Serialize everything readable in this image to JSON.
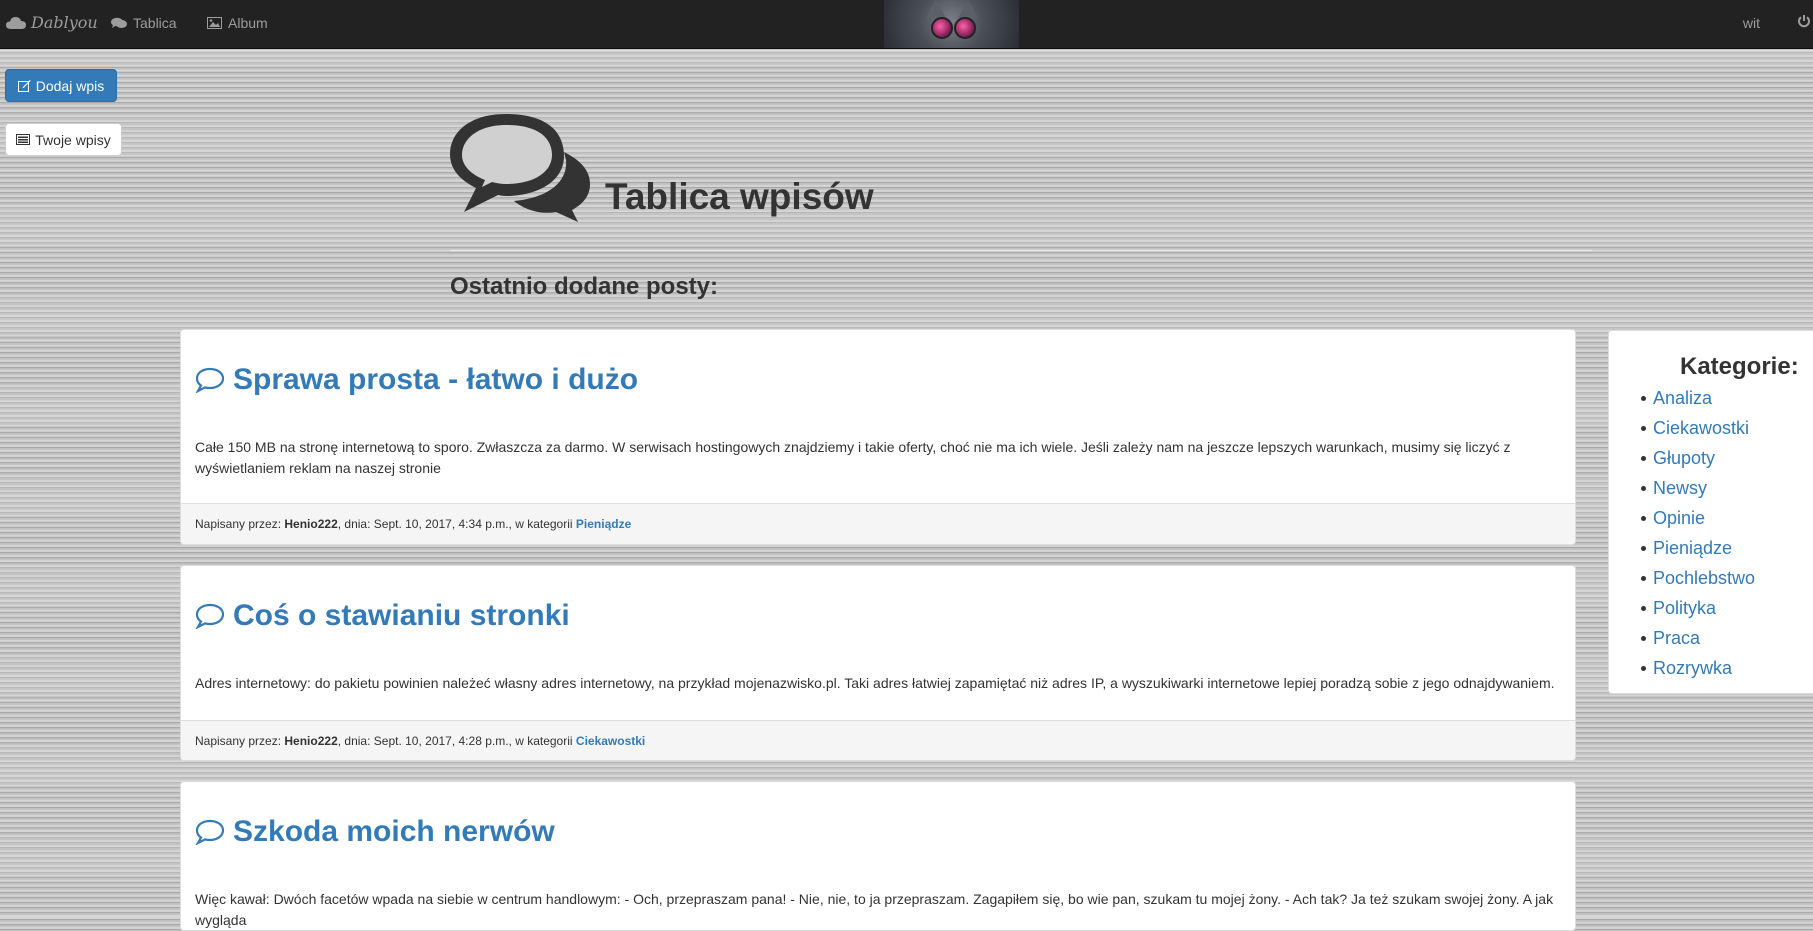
{
  "navbar": {
    "brand": "Dablyou",
    "tablica": "Tablica",
    "album": "Album",
    "user": "wit"
  },
  "sidebar": {
    "add_post": "Dodaj wpis",
    "my_posts": "Twoje wpisy"
  },
  "header": {
    "title": "Tablica wpisów",
    "subtitle": "Ostatnio dodane posty:"
  },
  "posts": [
    {
      "title": "Sprawa prosta - łatwo i dużo",
      "body": "Całe 150 MB na stronę internetową to sporo. Zwłaszcza za darmo. W serwisach hostingowych znajdziemy i takie oferty, choć nie ma ich wiele. Jeśli zależy nam na jeszcze lepszych warunkach, musimy się liczyć z wyświetlaniem reklam na naszej stronie",
      "footer_prefix": "Napisany przez:",
      "author": "Henio222",
      "footer_mid": ", dnia: Sept. 10, 2017, 4:34 p.m., w kategorii",
      "category": "Pieniądze"
    },
    {
      "title": "Coś o stawianiu stronki",
      "body": "Adres internetowy: do pakietu powinien należeć własny adres internetowy, na przykład mojenazwisko.pl. Taki adres łatwiej zapamiętać niż adres IP, a wyszukiwarki internetowe lepiej poradzą sobie z jego odnajdywaniem.",
      "footer_prefix": "Napisany przez:",
      "author": "Henio222",
      "footer_mid": ", dnia: Sept. 10, 2017, 4:28 p.m., w kategorii",
      "category": "Ciekawostki"
    },
    {
      "title": "Szkoda moich nerwów",
      "body": "Więc kawał: Dwóch facetów wpada na siebie w centrum handlowym: - Och, przepraszam pana! - Nie, nie, to ja przepraszam. Zagapiłem się, bo wie pan, szukam tu mojej żony. - Ach tak? Ja też szukam swojej żony. A jak wygląda"
    }
  ],
  "categories": {
    "title": "Kategorie:",
    "items": [
      "Analiza",
      "Ciekawostki",
      "Głupoty",
      "Newsy",
      "Opinie",
      "Pieniądze",
      "Pochlebstwo",
      "Polityka",
      "Praca",
      "Rozrywka"
    ]
  }
}
